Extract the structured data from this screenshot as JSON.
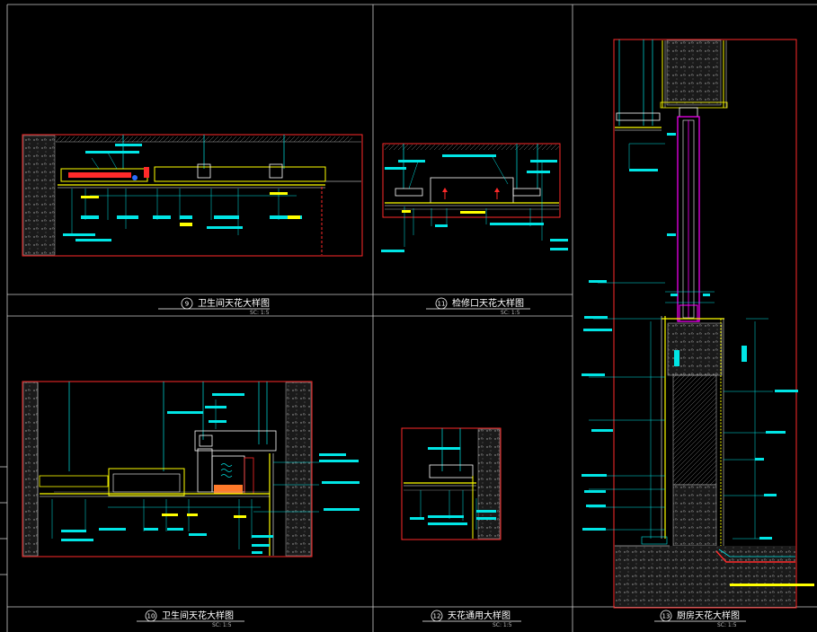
{
  "colors": {
    "background": "#000000",
    "frame": "#c8c8c8",
    "section_border": "#ff2a2a",
    "dimension": "#00e5e5",
    "finish": "#ffff00",
    "highlight": "#ff00ff",
    "fill_white": "#ffffff",
    "hatch": "#9a9a9a"
  },
  "details": [
    {
      "id": "d9",
      "number": "9",
      "title": "卫生间天花大样图",
      "scale": "SC: 1:5"
    },
    {
      "id": "d11",
      "number": "11",
      "title": "检修口天花大样图",
      "scale": "SC: 1:5"
    },
    {
      "id": "d10",
      "number": "10",
      "title": "卫生间天花大样图",
      "scale": "SC: 1:5"
    },
    {
      "id": "d12",
      "number": "12",
      "title": "天花通用大样图",
      "scale": "SC: 1:5"
    },
    {
      "id": "d13",
      "number": "13",
      "title": "厨房天花大样图",
      "scale": "SC: 1:5"
    }
  ]
}
